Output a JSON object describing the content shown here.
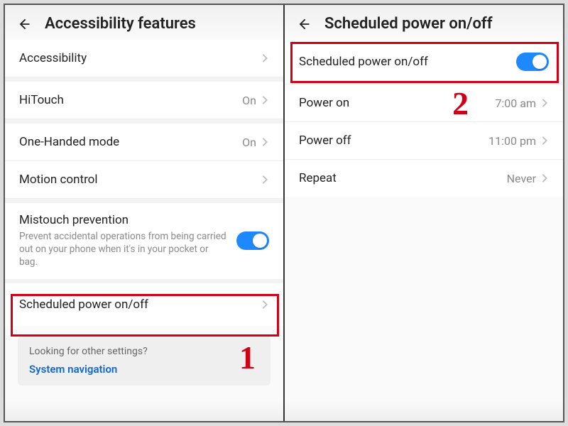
{
  "left": {
    "title": "Accessibility features",
    "rows": {
      "accessibility": {
        "label": "Accessibility"
      },
      "hitouch": {
        "label": "HiTouch",
        "value": "On"
      },
      "onehanded": {
        "label": "One-Handed mode",
        "value": "On"
      },
      "motion": {
        "label": "Motion control"
      },
      "mistouch": {
        "title": "Mistouch prevention",
        "desc": "Prevent accidental operations from being carried out on your phone when it's in your pocket or bag."
      },
      "scheduled": {
        "label": "Scheduled power on/off"
      }
    },
    "hint": {
      "q": "Looking for other settings?",
      "link": "System navigation"
    },
    "step": "1"
  },
  "right": {
    "title": "Scheduled power on/off",
    "rows": {
      "toggle": {
        "label": "Scheduled power on/off"
      },
      "poweron": {
        "label": "Power on",
        "value": "7:00 am"
      },
      "poweroff": {
        "label": "Power off",
        "value": "11:00 pm"
      },
      "repeat": {
        "label": "Repeat",
        "value": "Never"
      }
    },
    "step": "2"
  }
}
